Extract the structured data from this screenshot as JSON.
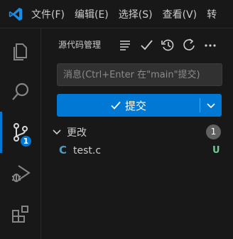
{
  "menu": {
    "items": [
      "文件(F)",
      "编辑(E)",
      "选择(S)",
      "查看(V)",
      "转"
    ]
  },
  "activity_bar": {
    "scm_badge": "1",
    "icons": [
      "explorer-icon",
      "search-icon",
      "source-control-icon",
      "run-debug-icon",
      "extensions-icon"
    ]
  },
  "scm": {
    "title": "源代码管理",
    "commit_placeholder": "消息(Ctrl+Enter 在\"main\"提交)",
    "commit_label": "提交",
    "changes_label": "更改",
    "changes_count": "1",
    "files": [
      {
        "icon": "C",
        "name": "test.c",
        "status": "U"
      }
    ]
  },
  "colors": {
    "accent": "#0078d4",
    "untracked": "#73c991",
    "c_file": "#519aba",
    "background": "#181818"
  }
}
